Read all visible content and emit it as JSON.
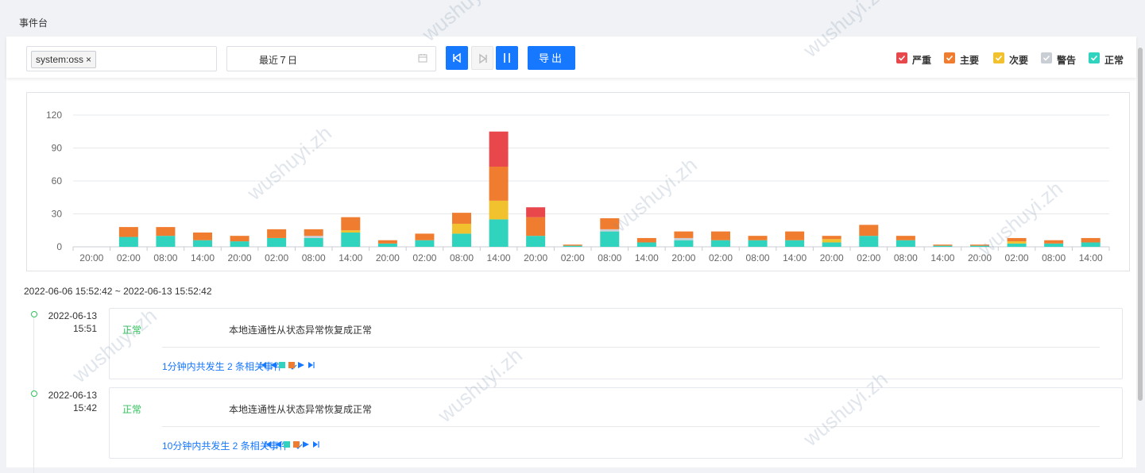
{
  "page": {
    "title": "事件台"
  },
  "filter": {
    "tag": "system:oss",
    "tag_close": "×",
    "date_range": "最近７日"
  },
  "toolbar": {
    "export_label": "导出"
  },
  "legend": [
    {
      "label": "严重",
      "color": "#e8474c"
    },
    {
      "label": "主要",
      "color": "#f07c2f"
    },
    {
      "label": "次要",
      "color": "#f2c12e"
    },
    {
      "label": "警告",
      "color": "#c9cdd4"
    },
    {
      "label": "正常",
      "color": "#2fd3be"
    }
  ],
  "chart_data": {
    "type": "bar",
    "stacked": true,
    "ylim": [
      0,
      120
    ],
    "yticks": [
      0,
      30,
      60,
      90,
      120
    ],
    "grid": true,
    "categories": [
      "20:00",
      "02:00",
      "08:00",
      "14:00",
      "20:00",
      "02:00",
      "08:00",
      "14:00",
      "20:00",
      "02:00",
      "08:00",
      "14:00",
      "20:00",
      "02:00",
      "08:00",
      "14:00",
      "20:00",
      "02:00",
      "08:00",
      "14:00",
      "20:00",
      "02:00",
      "08:00",
      "14:00",
      "20:00",
      "02:00",
      "08:00",
      "14:00"
    ],
    "series": [
      {
        "name": "正常",
        "color": "#2fd3be",
        "values": [
          0,
          9,
          10,
          6,
          5,
          8,
          8,
          13,
          3,
          6,
          12,
          25,
          10,
          1,
          14,
          4,
          6,
          6,
          6,
          6,
          4,
          10,
          6,
          1,
          1,
          3,
          3,
          4
        ]
      },
      {
        "name": "警告",
        "color": "#c9cdd4",
        "values": [
          0,
          0,
          0,
          0,
          0,
          0,
          2,
          0,
          0,
          0,
          0,
          0,
          0,
          0,
          2,
          0,
          2,
          0,
          0,
          0,
          0,
          0,
          0,
          0,
          0,
          0,
          0,
          0
        ]
      },
      {
        "name": "次要",
        "color": "#f2c12e",
        "values": [
          0,
          0,
          0,
          0,
          0,
          0,
          0,
          2,
          0,
          0,
          9,
          17,
          0,
          0,
          0,
          0,
          0,
          0,
          0,
          0,
          3,
          0,
          0,
          0,
          0,
          2,
          0,
          0
        ]
      },
      {
        "name": "主要",
        "color": "#f07c2f",
        "values": [
          0,
          9,
          8,
          7,
          5,
          8,
          6,
          12,
          3,
          6,
          10,
          31,
          17,
          1,
          10,
          4,
          6,
          8,
          4,
          8,
          3,
          10,
          4,
          1,
          1,
          3,
          3,
          4
        ]
      },
      {
        "name": "严重",
        "color": "#e8474c",
        "values": [
          0,
          0,
          0,
          0,
          0,
          0,
          0,
          0,
          0,
          0,
          0,
          32,
          9,
          0,
          0,
          0,
          0,
          0,
          0,
          0,
          0,
          0,
          0,
          0,
          0,
          0,
          0,
          0
        ]
      }
    ]
  },
  "timeline": {
    "range": "2022-06-06 15:52:42 ~ 2022-06-13 15:52:42",
    "events": [
      {
        "date": "2022-06-13",
        "time": "15:51",
        "severity": "正常",
        "message": "本地连通性从状态异常恢复成正常",
        "related": "1分钟内共发生 2 条相关事件"
      },
      {
        "date": "2022-06-13",
        "time": "15:42",
        "severity": "正常",
        "message": "本地连通性从状态异常恢复成正常",
        "related": "10分钟内共发生 2 条相关事件"
      }
    ]
  },
  "watermark": "wushuyi.zh"
}
